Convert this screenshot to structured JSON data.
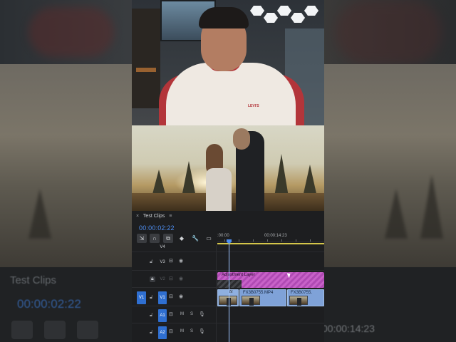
{
  "panel": {
    "close_glyph": "×",
    "title": "Test Clips",
    "menu_glyph": "≡",
    "timecode": "00:00:02:22"
  },
  "toolbar": {
    "tools": [
      {
        "name": "insert-sequence-icon",
        "glyph": "⇲"
      },
      {
        "name": "snap-magnet-icon",
        "glyph": "∩"
      },
      {
        "name": "linked-selection-icon",
        "glyph": "⧉"
      },
      {
        "name": "add-marker-icon",
        "glyph": "◆"
      },
      {
        "name": "wrench-settings-icon",
        "glyph": "🔧"
      },
      {
        "name": "captions-icon",
        "glyph": "▭"
      }
    ]
  },
  "ruler": {
    "start_label": ":00:00",
    "end_label": "00:00:14:23"
  },
  "tracks": [
    {
      "id": "v4",
      "label": "V4",
      "active": false
    },
    {
      "id": "v3",
      "label": "V3",
      "active": false
    },
    {
      "id": "v2",
      "label": "V2",
      "active": false
    },
    {
      "id": "v1",
      "label": "V1",
      "source": "V1",
      "active": true
    },
    {
      "id": "a1",
      "label": "A1",
      "active": true,
      "m": "M",
      "s": "S"
    },
    {
      "id": "a2",
      "label": "A2",
      "active": true,
      "m": "M",
      "s": "S"
    }
  ],
  "clips": {
    "adjustment_layer": "Adjustment Layer",
    "fx_badge": "fx",
    "v1_clip1": "FX3B0755.MP4",
    "v1_clip2": "FX3B0755."
  },
  "background": {
    "ghost_title": "Test Clips",
    "ghost_timecode": "00:00:02:22",
    "ghost_right_timecode": "00:00:14:23"
  },
  "colors": {
    "accent_blue": "#2f6fd1",
    "timecode_blue": "#4d8ef2",
    "adjustment_magenta": "#c862c8",
    "video_clip_blue": "#7fa2d8",
    "work_area_yellow": "#d4c64a",
    "shirt_red": "#b3353a"
  }
}
